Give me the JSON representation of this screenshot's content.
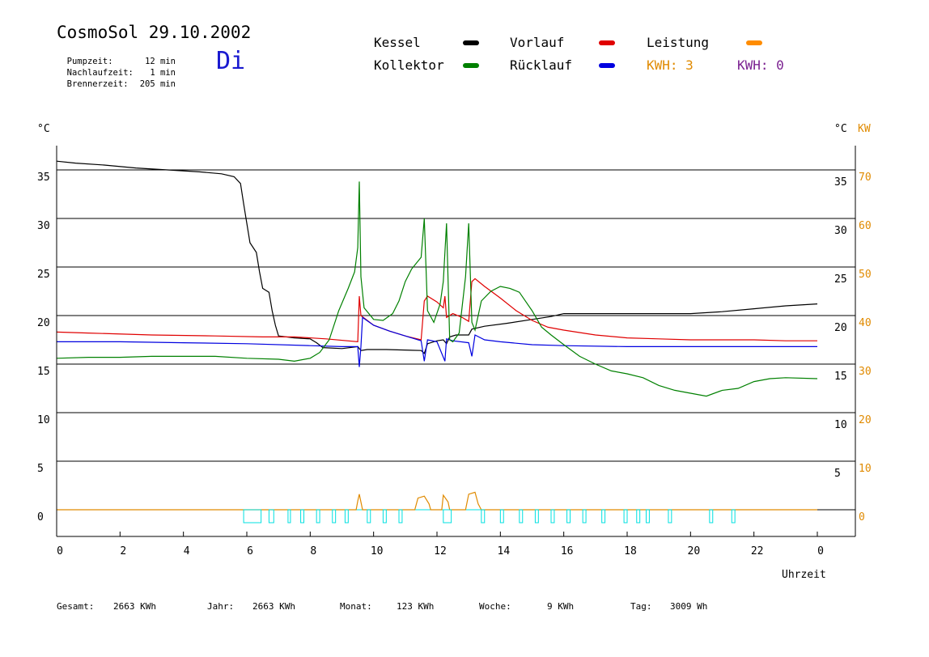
{
  "header": {
    "title": "CosmoSol 29.10.2002",
    "weekday": "Di",
    "stats": [
      {
        "label": "Pumpzeit:",
        "value": "12 min"
      },
      {
        "label": "Nachlaufzeit:",
        "value": "1 min"
      },
      {
        "label": "Brennerzeit:",
        "value": "205 min"
      }
    ]
  },
  "legend": {
    "kessel": {
      "label": "Kessel",
      "color": "#000000"
    },
    "vorlauf": {
      "label": "Vorlauf",
      "color": "#e00000"
    },
    "leistung": {
      "label": "Leistung",
      "color": "#ff8c00"
    },
    "kollektor": {
      "label": "Kollektor",
      "color": "#008000"
    },
    "ruecklauf": {
      "label": "Rücklauf",
      "color": "#0000e0"
    },
    "kwh1": {
      "label": "KWH: 3",
      "color": "#e08a00"
    },
    "kwh2": {
      "label": "KWH: 0",
      "color": "#7a2090"
    }
  },
  "footer": {
    "gesamt_label": "Gesamt:",
    "gesamt_value": "2663 KWh",
    "jahr_label": "Jahr:",
    "jahr_value": "2663 KWh",
    "monat_label": "Monat:",
    "monat_value": "123 KWh",
    "woche_label": "Woche:",
    "woche_value": "9 KWh",
    "tag_label": "Tag:",
    "tag_value": "3009 Wh"
  },
  "chart_data": {
    "type": "line",
    "title": "CosmoSol 29.10.2002",
    "xlabel": "Uhrzeit",
    "ylabel_left": "°C",
    "ylabel_right_temp": "°C",
    "ylabel_right_power": "KW",
    "xlim": [
      0,
      24
    ],
    "ylim": [
      -2.5,
      38
    ],
    "x_ticks": [
      "0",
      "2",
      "4",
      "6",
      "8",
      "10",
      "12",
      "14",
      "16",
      "18",
      "20",
      "22",
      "0"
    ],
    "y_ticks": [
      0,
      5,
      10,
      15,
      20,
      25,
      30,
      35
    ],
    "y_ticks_right_temp": [
      5,
      10,
      15,
      20,
      25,
      30,
      35
    ],
    "y_ticks_right_power": [
      0,
      10,
      20,
      30,
      40,
      50,
      60,
      70
    ],
    "grid": "horizontal",
    "series": [
      {
        "name": "Kessel",
        "color": "#000000",
        "points": [
          [
            0,
            35.9
          ],
          [
            0.6,
            35.7
          ],
          [
            1.5,
            35.5
          ],
          [
            2.5,
            35.2
          ],
          [
            3.5,
            35.0
          ],
          [
            4.5,
            34.8
          ],
          [
            5.2,
            34.6
          ],
          [
            5.6,
            34.3
          ],
          [
            5.8,
            33.6
          ],
          [
            5.9,
            31.5
          ],
          [
            6.0,
            29.5
          ],
          [
            6.1,
            27.5
          ],
          [
            6.3,
            26.5
          ],
          [
            6.4,
            24.5
          ],
          [
            6.5,
            22.8
          ],
          [
            6.7,
            22.4
          ],
          [
            6.8,
            20.5
          ],
          [
            6.9,
            19.0
          ],
          [
            7.0,
            17.9
          ],
          [
            7.5,
            17.7
          ],
          [
            8.0,
            17.6
          ],
          [
            8.2,
            17.2
          ],
          [
            8.4,
            16.7
          ],
          [
            9.0,
            16.6
          ],
          [
            9.5,
            16.8
          ],
          [
            9.6,
            16.4
          ],
          [
            9.8,
            16.5
          ],
          [
            10.4,
            16.5
          ],
          [
            11.5,
            16.4
          ],
          [
            11.6,
            16.1
          ],
          [
            11.7,
            17.1
          ],
          [
            12.0,
            17.4
          ],
          [
            12.2,
            17.5
          ],
          [
            12.3,
            17.1
          ],
          [
            12.4,
            17.8
          ],
          [
            12.6,
            18.0
          ],
          [
            13.0,
            18.0
          ],
          [
            13.1,
            18.6
          ],
          [
            13.5,
            18.9
          ],
          [
            14.2,
            19.2
          ],
          [
            15.0,
            19.6
          ],
          [
            15.6,
            19.9
          ],
          [
            16.0,
            20.2
          ],
          [
            17.0,
            20.2
          ],
          [
            18.0,
            20.2
          ],
          [
            19.0,
            20.2
          ],
          [
            20.0,
            20.2
          ],
          [
            21.0,
            20.4
          ],
          [
            22.0,
            20.7
          ],
          [
            23.0,
            21.0
          ],
          [
            24.0,
            21.2
          ]
        ]
      },
      {
        "name": "Vorlauf",
        "color": "#e00000",
        "points": [
          [
            0,
            18.3
          ],
          [
            1.0,
            18.2
          ],
          [
            3.0,
            18.0
          ],
          [
            5.0,
            17.9
          ],
          [
            6.5,
            17.8
          ],
          [
            7.5,
            17.8
          ],
          [
            8.5,
            17.6
          ],
          [
            9.5,
            17.3
          ],
          [
            9.55,
            22.0
          ],
          [
            9.6,
            20.0
          ],
          [
            10.0,
            19.0
          ],
          [
            10.5,
            18.4
          ],
          [
            11.0,
            17.9
          ],
          [
            11.5,
            17.5
          ],
          [
            11.6,
            21.5
          ],
          [
            11.7,
            22.0
          ],
          [
            12.0,
            21.4
          ],
          [
            12.2,
            20.8
          ],
          [
            12.25,
            22.0
          ],
          [
            12.3,
            19.8
          ],
          [
            12.5,
            20.2
          ],
          [
            12.8,
            19.8
          ],
          [
            13.0,
            19.4
          ],
          [
            13.1,
            23.5
          ],
          [
            13.2,
            23.8
          ],
          [
            13.5,
            23.0
          ],
          [
            14.0,
            21.8
          ],
          [
            14.5,
            20.5
          ],
          [
            15.0,
            19.5
          ],
          [
            15.5,
            18.8
          ],
          [
            16.0,
            18.5
          ],
          [
            17.0,
            18.0
          ],
          [
            18.0,
            17.7
          ],
          [
            19.0,
            17.6
          ],
          [
            20.0,
            17.5
          ],
          [
            21.0,
            17.5
          ],
          [
            22.0,
            17.5
          ],
          [
            23.0,
            17.4
          ],
          [
            24.0,
            17.4
          ]
        ]
      },
      {
        "name": "Rücklauf",
        "color": "#0000e0",
        "points": [
          [
            0,
            17.3
          ],
          [
            2.0,
            17.3
          ],
          [
            4.0,
            17.2
          ],
          [
            6.0,
            17.1
          ],
          [
            8.0,
            16.9
          ],
          [
            9.0,
            16.8
          ],
          [
            9.5,
            16.8
          ],
          [
            9.55,
            14.7
          ],
          [
            9.6,
            16.8
          ],
          [
            9.65,
            19.8
          ],
          [
            10.0,
            19.0
          ],
          [
            10.5,
            18.4
          ],
          [
            11.0,
            17.9
          ],
          [
            11.5,
            17.4
          ],
          [
            11.6,
            15.3
          ],
          [
            11.7,
            17.5
          ],
          [
            12.0,
            17.3
          ],
          [
            12.25,
            15.3
          ],
          [
            12.3,
            17.6
          ],
          [
            12.5,
            17.4
          ],
          [
            13.0,
            17.2
          ],
          [
            13.1,
            15.8
          ],
          [
            13.2,
            18.0
          ],
          [
            13.5,
            17.5
          ],
          [
            14.0,
            17.3
          ],
          [
            15.0,
            17.0
          ],
          [
            16.0,
            16.9
          ],
          [
            18.0,
            16.8
          ],
          [
            20.0,
            16.8
          ],
          [
            22.0,
            16.8
          ],
          [
            24.0,
            16.8
          ]
        ]
      },
      {
        "name": "Kollektor",
        "color": "#008000",
        "points": [
          [
            0,
            15.6
          ],
          [
            1.0,
            15.7
          ],
          [
            2.0,
            15.7
          ],
          [
            3.0,
            15.8
          ],
          [
            4.0,
            15.8
          ],
          [
            5.0,
            15.8
          ],
          [
            6.0,
            15.6
          ],
          [
            7.0,
            15.5
          ],
          [
            7.5,
            15.3
          ],
          [
            8.0,
            15.6
          ],
          [
            8.3,
            16.2
          ],
          [
            8.6,
            17.5
          ],
          [
            8.9,
            20.5
          ],
          [
            9.2,
            22.8
          ],
          [
            9.4,
            24.5
          ],
          [
            9.5,
            27.0
          ],
          [
            9.55,
            33.8
          ],
          [
            9.6,
            24.0
          ],
          [
            9.7,
            20.8
          ],
          [
            10.0,
            19.6
          ],
          [
            10.3,
            19.5
          ],
          [
            10.6,
            20.2
          ],
          [
            10.8,
            21.5
          ],
          [
            11.0,
            23.5
          ],
          [
            11.2,
            24.8
          ],
          [
            11.5,
            26.0
          ],
          [
            11.6,
            30.0
          ],
          [
            11.7,
            20.5
          ],
          [
            11.9,
            19.3
          ],
          [
            12.1,
            21.2
          ],
          [
            12.2,
            23.5
          ],
          [
            12.3,
            29.5
          ],
          [
            12.4,
            17.5
          ],
          [
            12.5,
            17.3
          ],
          [
            12.7,
            18.2
          ],
          [
            12.9,
            24.0
          ],
          [
            13.0,
            29.5
          ],
          [
            13.1,
            19.3
          ],
          [
            13.2,
            18.5
          ],
          [
            13.4,
            21.5
          ],
          [
            13.7,
            22.5
          ],
          [
            14.0,
            23.0
          ],
          [
            14.3,
            22.8
          ],
          [
            14.6,
            22.4
          ],
          [
            15.0,
            20.5
          ],
          [
            15.3,
            18.8
          ],
          [
            15.6,
            18.0
          ],
          [
            16.0,
            17.0
          ],
          [
            16.5,
            15.8
          ],
          [
            17.0,
            15.0
          ],
          [
            17.5,
            14.3
          ],
          [
            18.0,
            14.0
          ],
          [
            18.5,
            13.6
          ],
          [
            19.0,
            12.8
          ],
          [
            19.5,
            12.3
          ],
          [
            20.0,
            12.0
          ],
          [
            20.5,
            11.7
          ],
          [
            21.0,
            12.3
          ],
          [
            21.5,
            12.5
          ],
          [
            22.0,
            13.2
          ],
          [
            22.5,
            13.5
          ],
          [
            23.0,
            13.6
          ],
          [
            24.0,
            13.5
          ]
        ]
      },
      {
        "name": "Leistung",
        "color": "#e08a00",
        "points": [
          [
            0,
            0
          ],
          [
            9.45,
            0
          ],
          [
            9.5,
            0.9
          ],
          [
            9.55,
            1.6
          ],
          [
            9.6,
            0.8
          ],
          [
            9.65,
            0
          ],
          [
            11.3,
            0
          ],
          [
            11.4,
            1.2
          ],
          [
            11.6,
            1.4
          ],
          [
            11.75,
            0.6
          ],
          [
            11.8,
            0
          ],
          [
            12.15,
            0
          ],
          [
            12.2,
            1.5
          ],
          [
            12.35,
            0.8
          ],
          [
            12.4,
            0
          ],
          [
            12.9,
            0
          ],
          [
            13.0,
            1.6
          ],
          [
            13.2,
            1.8
          ],
          [
            13.3,
            0.6
          ],
          [
            13.4,
            0
          ],
          [
            24,
            0
          ]
        ]
      },
      {
        "name": "Kessel Brenner",
        "color": "#00e0e0",
        "pulses": [
          [
            5.9,
            6.45
          ],
          [
            6.7,
            6.85
          ],
          [
            7.3,
            7.35
          ],
          [
            7.7,
            7.8
          ],
          [
            8.2,
            8.3
          ],
          [
            8.7,
            8.8
          ],
          [
            9.1,
            9.2
          ],
          [
            9.8,
            9.9
          ],
          [
            10.3,
            10.4
          ],
          [
            10.8,
            10.9
          ],
          [
            12.2,
            12.45
          ],
          [
            13.4,
            13.5
          ],
          [
            14.0,
            14.1
          ],
          [
            14.6,
            14.7
          ],
          [
            15.1,
            15.2
          ],
          [
            15.6,
            15.7
          ],
          [
            16.1,
            16.2
          ],
          [
            16.6,
            16.7
          ],
          [
            17.2,
            17.3
          ],
          [
            17.9,
            18.0
          ],
          [
            18.3,
            18.4
          ],
          [
            18.6,
            18.7
          ],
          [
            19.3,
            19.4
          ],
          [
            20.6,
            20.7
          ],
          [
            21.3,
            21.4
          ]
        ]
      }
    ]
  }
}
